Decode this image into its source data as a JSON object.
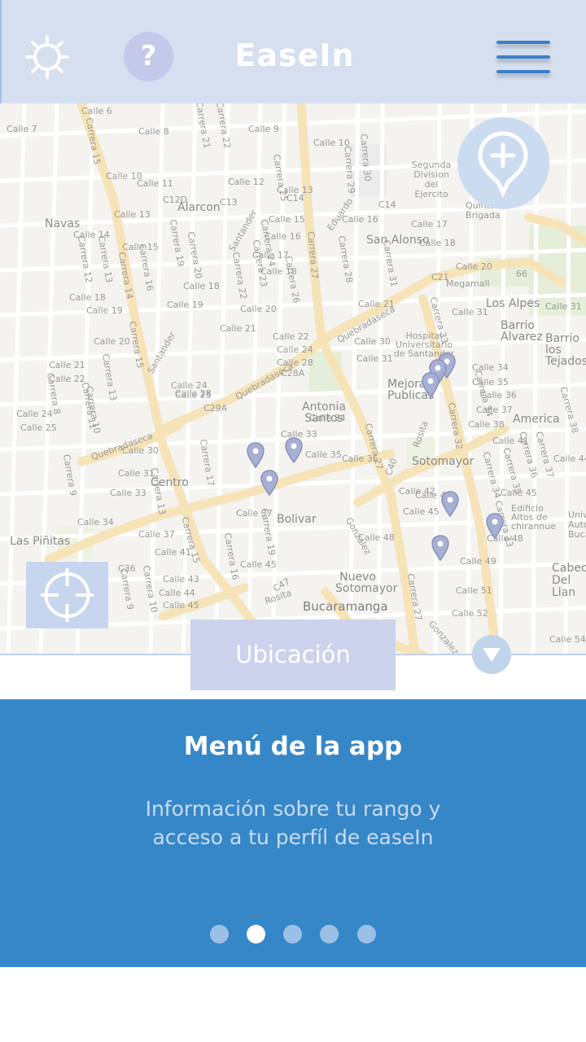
{
  "header": {
    "title": "EaseIn",
    "settings_icon": "gear-icon",
    "help_label": "?",
    "menu_icon": "hamburger-menu-icon"
  },
  "map": {
    "add_location_icon": "add-location-pin-icon",
    "locate_icon": "crosshair-icon",
    "labels": {
      "calle6": "Calle 6",
      "calle7": "Calle 7",
      "calle8": "Calle 8",
      "calle9": "Calle 9",
      "calle10": "Calle 10",
      "calle11": "Calle 11",
      "calle12": "Calle 12",
      "calle13": "Calle 13",
      "calle14": "Calle 14",
      "calle15": "Calle 15",
      "calle16": "Calle 16",
      "calle17": "Calle 17",
      "calle18": "Calle 18",
      "calle19": "Calle 19",
      "calle20": "Calle 20",
      "calle21": "Calle 21",
      "calle22": "Calle 22",
      "calle24": "Calle 24",
      "calle25": "Calle 25",
      "calle28": "Calle 28",
      "calle30": "Calle 30",
      "calle31": "Calle 31",
      "calle33": "Calle 33",
      "calle34": "Calle 34",
      "calle35": "Calle 35",
      "calle36": "Calle 36",
      "calle37": "Calle 37",
      "calle38": "Calle 38",
      "calle41": "Calle 41",
      "calle42": "Calle 42",
      "calle43": "Calle 43",
      "calle44": "Calle 44",
      "calle45": "Calle 45",
      "calle48": "Calle 48",
      "calle49": "Calle 49",
      "calle51": "Calle 51",
      "calle52": "Calle 52",
      "calle54": "Calle 54",
      "carrera15": "Carrera 15",
      "carrera27": "Carrera 27",
      "carrera33": "Carrera 33",
      "carrera21": "Carrera 21",
      "carrera22": "Carrera 22",
      "carrera25": "Carrera 25",
      "carrera29": "Carrera 29",
      "carrera30": "Carrera 30",
      "carrera17": "Carrera 17",
      "carrera13": "Carrera 13",
      "carrera12": "Carrera 12",
      "carrera14": "Carrera 14",
      "carrera16": "Carrera 16",
      "carrera19": "Carrera 19",
      "carrera20": "Carrera 20",
      "carrera23": "Carrera 23",
      "carrera24": "Carrera 24",
      "carrera26": "Carrera 26",
      "carrera28": "Carrera 28",
      "carrera31": "Carrera 31",
      "carrera32": "Carrera 32",
      "carrera34": "Carrera 34",
      "carrera35": "Carrera 35",
      "carrera36": "Carrera 36",
      "carrera37": "Carrera 37",
      "carrera38": "Carrera 38",
      "carrera10": "Carrera 10",
      "carrera9": "Carrera 9",
      "carrera8": "Carrera 8",
      "carrera11": "Carrera 11",
      "c12d": "C12D",
      "c13": "C13",
      "c14": "C14",
      "c21": "C21",
      "c28a": "C28A",
      "c29a": "C29A",
      "c36": "C36",
      "c40": "C40",
      "c47": "C47",
      "alarcon": "Alarcon",
      "navas": "Navas",
      "san_alonso": "San Alonso",
      "segunda_division": "Segunda Division del Ejercito",
      "quinta_brigada": "Quinta Brigada",
      "megamall": "Megamall",
      "los_alpes": "Los Alpes",
      "barrio_alvarez": "Barrio Alvarez",
      "barrio_tejados": "Barrio los Tejados",
      "hospital": "Hospital Universitario de Santander",
      "mejoras_publicas": "Mejoras Publicas",
      "antonia_santos": "Antonia Santos",
      "america": "America",
      "sotomayor": "Sotomayor",
      "centro": "Centro",
      "bolivar": "Bolivar",
      "las_pinitas": "Las Piñitas",
      "nuevo_sotomayor": "Nuevo Sotomayor",
      "bucaramanga": "Bucaramanga",
      "edificio": "Edificio Altos de chirannue",
      "univ_autonoma": "Univ Auto Buca",
      "cabecera": "Cabecer Del Llan",
      "quebradaseca": "Quebradaseca",
      "rosita": "Rosita",
      "gonzalez": "Gonzalez",
      "eduardo": "Eduardo",
      "santander": "Santander",
      "hwy66": "66"
    }
  },
  "location": {
    "button_label": "Ubicación",
    "collapse_icon": "triangle-down-icon"
  },
  "tutorial": {
    "heading": "Menú de la app",
    "description": "Información sobre tu rango y acceso a tu perfíl de easeIn",
    "page_count": 5,
    "active_page": 2
  },
  "colors": {
    "header_bg": "#d5dff0",
    "panel_bg": "#3687c8",
    "accent": "#3d7fc9",
    "button_bg": "#cdd3ec"
  }
}
